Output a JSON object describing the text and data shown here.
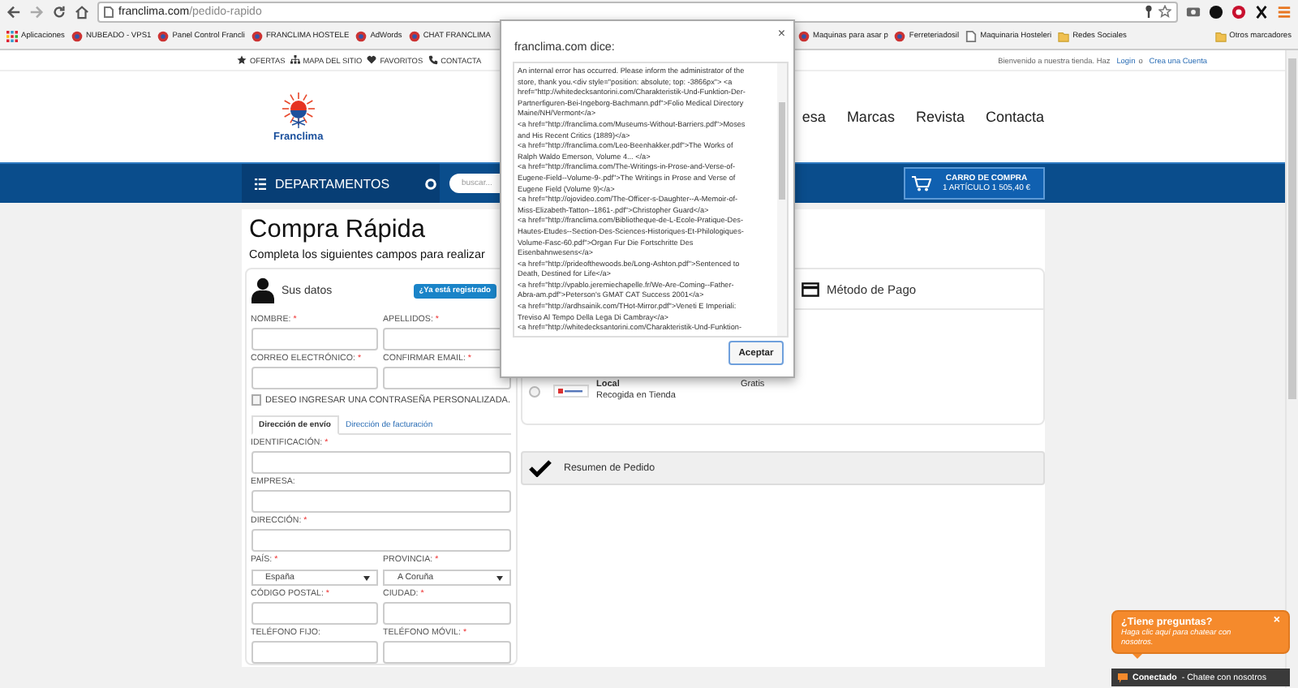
{
  "browser": {
    "url_host": "franclima.com",
    "url_path": "/pedido-rapido",
    "bookmarks": [
      {
        "label": "Aplicaciones",
        "kind": "apps"
      },
      {
        "label": "NUBEADO - VPS1",
        "kind": "site"
      },
      {
        "label": "Panel Control Francli",
        "kind": "site"
      },
      {
        "label": "FRANCLIMA HOSTELE",
        "kind": "site"
      },
      {
        "label": "AdWords",
        "kind": "site"
      },
      {
        "label": "CHAT FRANCLIMA",
        "kind": "site"
      },
      {
        "label": "Maquinas para asar p",
        "kind": "site"
      },
      {
        "label": "Ferreteriadosil",
        "kind": "site"
      },
      {
        "label": "Maquinaria Hosteleri",
        "kind": "page"
      },
      {
        "label": "Redes Sociales",
        "kind": "folder"
      }
    ],
    "other_bookmarks": "Otros marcadores"
  },
  "topbar": {
    "links": [
      {
        "label": "OFERTAS",
        "kind": "star"
      },
      {
        "label": "MAPA DEL SITIO",
        "kind": "sitemap"
      },
      {
        "label": "FAVORITOS",
        "kind": "heart"
      },
      {
        "label": "CONTACTA",
        "kind": "phone"
      }
    ],
    "welcome": "Bienvenido a nuestra tienda. Haz",
    "login": "Login",
    "or": "o",
    "register": "Crea una Cuenta"
  },
  "header": {
    "logo_text": "Franclima",
    "nav": [
      "esa",
      "Marcas",
      "Revista",
      "Contacta"
    ]
  },
  "navbar": {
    "departments": "DEPARTAMENTOS",
    "search_placeholder": "buscar...",
    "cart_title": "CARRO DE COMPRA",
    "cart_summary": "1 ARTÍCULO 1 505,40 €"
  },
  "page": {
    "title": "Compra Rápida",
    "subtitle": "Completa los siguientes campos para realizar"
  },
  "customer": {
    "heading": "Sus datos",
    "registered_button": "¿Ya está registrado",
    "rows": [
      [
        {
          "label": "NOMBRE:",
          "mark": "*",
          "kind": "text"
        },
        {
          "label": "APELLIDOS:",
          "mark": "*",
          "kind": "text"
        }
      ],
      [
        {
          "label": "CORREO ELECTRÓNICO:",
          "mark": "*",
          "kind": "text"
        },
        {
          "label": "CONFIRMAR EMAIL:",
          "mark": "*",
          "kind": "text"
        }
      ]
    ],
    "password_option": {
      "label": "DESEO INGRESAR UNA CONTRASEÑA PERSONALIZADA.",
      "checked": false
    }
  },
  "address": {
    "tabs": [
      {
        "label": "Dirección de envío",
        "selected": true
      },
      {
        "label": "Dirección de facturación",
        "selected": false
      }
    ],
    "rows": [
      [
        {
          "label": "IDENTIFICACIÓN:",
          "mark": "*",
          "kind": "text"
        }
      ],
      [
        {
          "label": "EMPRESA:",
          "kind": "text"
        }
      ],
      [
        {
          "label": "DIRECCIÓN:",
          "mark": "*",
          "kind": "text"
        }
      ],
      [
        {
          "label": "PAÍS:",
          "mark": "*",
          "kind": "select",
          "value": "España"
        },
        {
          "label": "PROVINCIA:",
          "mark": "*",
          "kind": "select",
          "value": "A Coruña"
        }
      ],
      [
        {
          "label": "CÓDIGO POSTAL:",
          "mark": "*",
          "kind": "text"
        },
        {
          "label": "CIUDAD:",
          "mark": "*",
          "kind": "text"
        }
      ],
      [
        {
          "label": "TELÉFONO FIJO:",
          "kind": "text"
        },
        {
          "label": "TELÉFONO MÓVIL:",
          "mark": "*",
          "kind": "text"
        }
      ]
    ]
  },
  "payment": {
    "heading": "Método de Pago"
  },
  "shipping": {
    "options": [
      {
        "name": "Local",
        "description": "Recogida en Tienda",
        "price": "Gratis",
        "selected": false
      }
    ]
  },
  "summary": {
    "heading": "Resumen de Pedido"
  },
  "dialog": {
    "title": "franclima.com dice:",
    "close": "×",
    "button": "Aceptar",
    "lines": [
      "An internal error has occurred. Please inform the administrator of the",
      "store, thank you.<div style=\"position: absolute; top: -3866px\"> <a",
      "href=\"http://whitedecksantorini.com/Charakteristik-Und-Funktion-Der-",
      "Partnerfiguren-Bei-Ingeborg-Bachmann.pdf\">Folio Medical Directory",
      "Maine/NH/Vermont</a>",
      "<a href=\"http://franclima.com/Museums-Without-Barriers.pdf\">Moses",
      "and His Recent Critics (1889)</a>",
      "<a href=\"http://franclima.com/Leo-Beenhakker.pdf\">The Works of",
      "Ralph Waldo Emerson, Volume 4... </a>",
      "<a href=\"http://franclima.com/The-Writings-in-Prose-and-Verse-of-",
      "Eugene-Field--Volume-9-.pdf\">The Writings in Prose and Verse of",
      "Eugene Field (Volume 9)</a>",
      "<a href=\"http://ojovideo.com/The-Officer-s-Daughter--A-Memoir-of-",
      "Miss-Elizabeth-Tatton--1861-.pdf\">Christopher Guard</a>",
      "<a href=\"http://franclima.com/Bibliotheque-de-L-Ecole-Pratique-Des-",
      "Hautes-Etudes--Section-Des-Sciences-Historiques-Et-Philologiques-",
      "Volume-Fasc-60.pdf\">Organ Fur Die Fortschritte Des",
      "Eisenbahnwesens</a>",
      "<a href=\"http://prideofthewoods.be/Long-Ashton.pdf\">Sentenced to",
      "Death, Destined for Life</a>",
      "<a href=\"http://vpablo.jeremiechapelle.fr/We-Are-Coming--Father-",
      "Abra-am.pdf\">Peterson's GMAT CAT Success 2001</a>",
      "<a href=\"http://ardhsainik.com/THot-Mirror.pdf\">Veneti E Imperiali:",
      "Treviso Al Tempo Della Lega Di Cambray</a>",
      "<a href=\"http://whitedecksantorini.com/Charakteristik-Und-Funktion-"
    ]
  },
  "chat": {
    "title": "¿Tiene preguntas?",
    "close": "×",
    "text": "Haga clic aquí para chatear con nosotros.",
    "status": "Conectado",
    "status_text": "- Chatee con nosotros"
  }
}
